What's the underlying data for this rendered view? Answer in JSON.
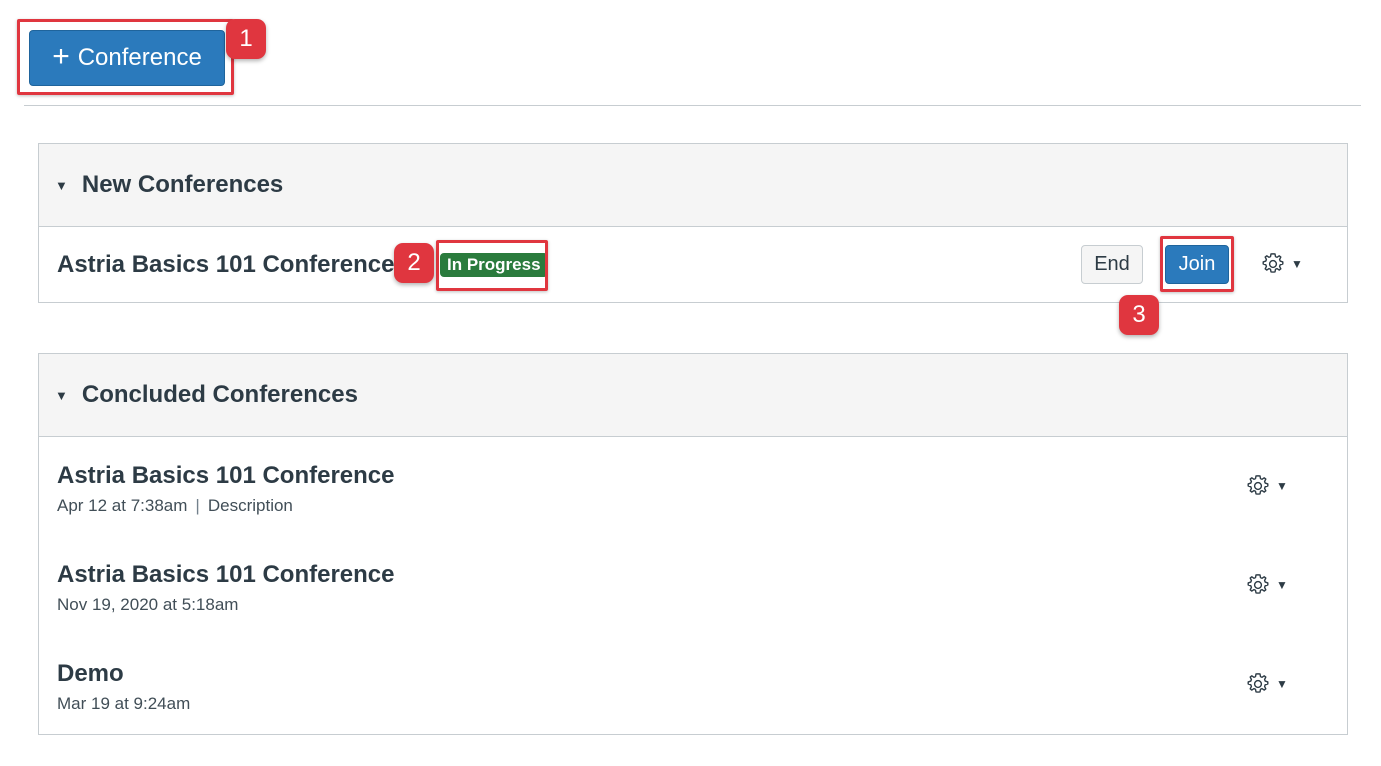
{
  "toolbar": {
    "add_icon": "plus-icon",
    "add_label": "Conference"
  },
  "new_section": {
    "title": "New Conferences",
    "items": [
      {
        "title": "Astria Basics 101 Conference te",
        "badge": "In Progress",
        "end_label": "End",
        "join_label": "Join"
      }
    ]
  },
  "concluded_section": {
    "title": "Concluded Conferences",
    "items": [
      {
        "title": "Astria Basics 101 Conference",
        "date": "Apr 12 at 7:38am",
        "separator": "|",
        "description": "Description"
      },
      {
        "title": "Astria Basics 101 Conference",
        "date": "Nov 19, 2020 at 5:18am"
      },
      {
        "title": "Demo",
        "date": "Mar 19 at 9:24am"
      }
    ]
  },
  "callouts": [
    "1",
    "2",
    "3"
  ],
  "colors": {
    "primary": "#2b7abc",
    "success": "#2a7b3d",
    "callout": "#e0363f",
    "text": "#2d3b45"
  }
}
